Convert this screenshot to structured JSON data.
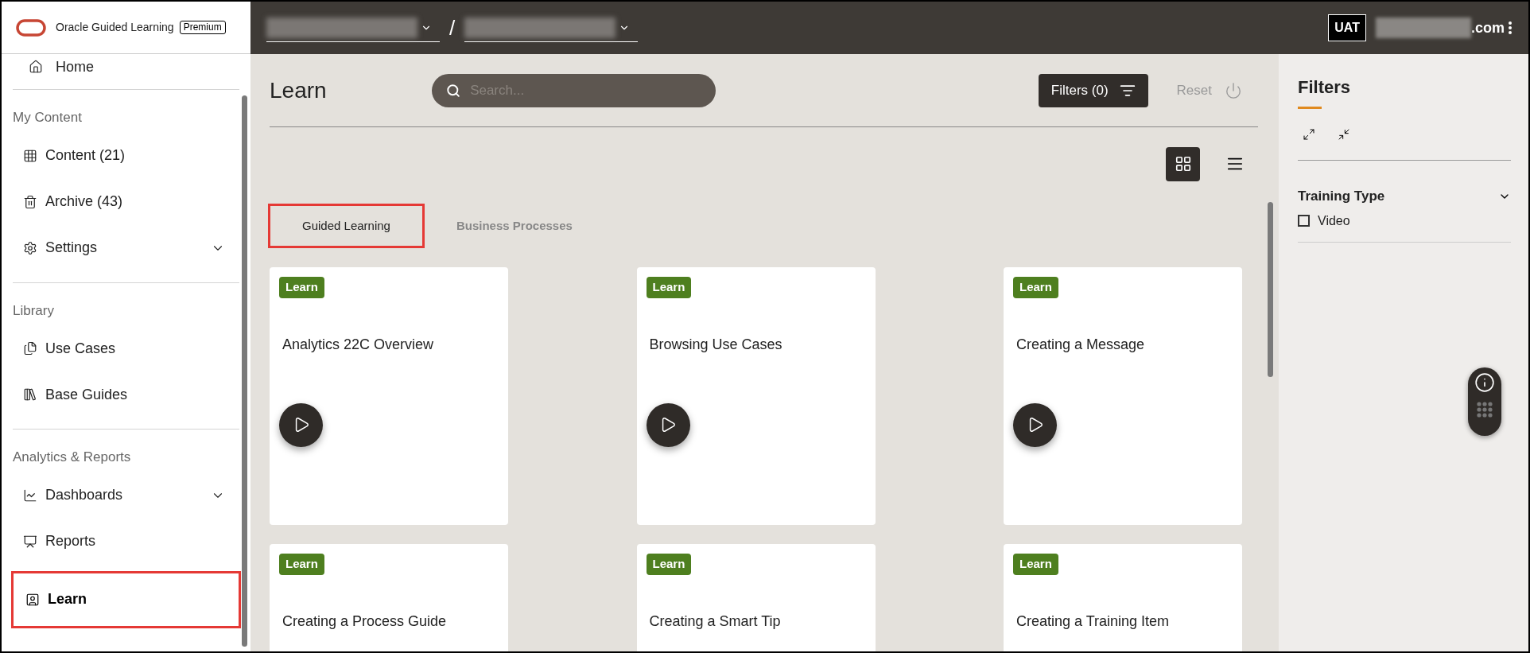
{
  "app": {
    "name": "Oracle Guided Learning",
    "edition": "Premium"
  },
  "top_bar": {
    "separator": "/",
    "environment": "UAT",
    "account_suffix": ".com"
  },
  "sidebar": {
    "top_item": {
      "label": "Home"
    },
    "sections": [
      {
        "heading": "My Content",
        "items": [
          {
            "label": "Content (21)",
            "kind": "link",
            "selected": false
          },
          {
            "label": "Archive (43)",
            "kind": "link",
            "selected": false
          },
          {
            "label": "Settings",
            "kind": "group",
            "expanded": false,
            "selected": false
          }
        ]
      },
      {
        "heading": "Library",
        "items": [
          {
            "label": "Use Cases",
            "kind": "link",
            "selected": false
          },
          {
            "label": "Base Guides",
            "kind": "link",
            "selected": false
          }
        ]
      },
      {
        "heading": "Analytics & Reports",
        "items": [
          {
            "label": "Dashboards",
            "kind": "group",
            "expanded": false,
            "selected": false
          },
          {
            "label": "Reports",
            "kind": "link",
            "selected": false
          },
          {
            "label": "Learn",
            "kind": "link",
            "selected": true
          }
        ]
      }
    ]
  },
  "page": {
    "title": "Learn",
    "search": {
      "placeholder": "Search..."
    },
    "filters_button": "Filters (0)",
    "reset": "Reset",
    "views": [
      {
        "kind": "grid",
        "selected": true
      },
      {
        "kind": "list",
        "selected": false
      }
    ],
    "tabs": [
      {
        "label": "Guided Learning",
        "selected": true
      },
      {
        "label": "Business Processes",
        "selected": false
      }
    ],
    "cards": [
      {
        "badge": "Learn",
        "title": "Analytics 22C Overview"
      },
      {
        "badge": "Learn",
        "title": "Browsing Use Cases"
      },
      {
        "badge": "Learn",
        "title": "Creating a Message"
      },
      {
        "badge": "Learn",
        "title": "Creating a Process Guide"
      },
      {
        "badge": "Learn",
        "title": "Creating a Smart Tip"
      },
      {
        "badge": "Learn",
        "title": "Creating a Training Item"
      }
    ]
  },
  "filters_panel": {
    "title": "Filters",
    "groups": [
      {
        "title": "Training Type",
        "expanded": true,
        "options": [
          {
            "label": "Video",
            "checked": false
          }
        ]
      }
    ]
  }
}
